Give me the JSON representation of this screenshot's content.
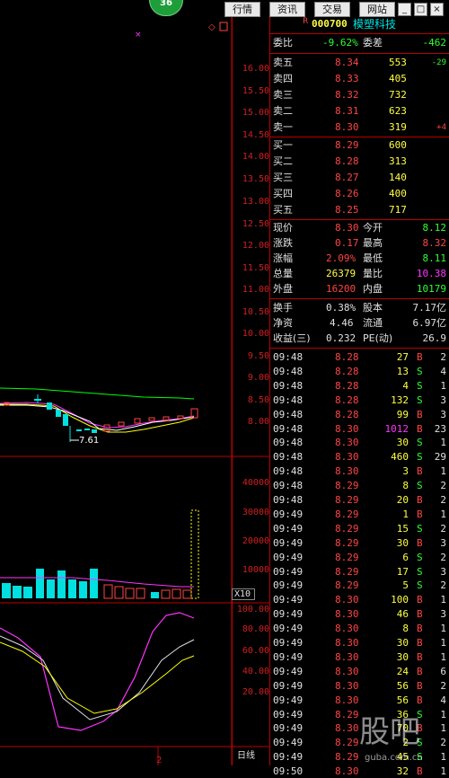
{
  "topbar": {
    "badge": "36",
    "buttons": [
      "行情",
      "资讯",
      "交易",
      "网站"
    ],
    "win_icons": [
      "minimize-icon",
      "maximize-icon",
      "close-icon"
    ]
  },
  "stock": {
    "marker": "R",
    "code": "000700",
    "name": "模塑科技"
  },
  "commission": {
    "wei_bi_label": "委比",
    "wei_bi": "-9.62%",
    "wei_cha_label": "委差",
    "wei_cha": "-462"
  },
  "sells": [
    {
      "label": "卖五",
      "price": "8.34",
      "vol": "553",
      "chg": "-29"
    },
    {
      "label": "卖四",
      "price": "8.33",
      "vol": "405",
      "chg": ""
    },
    {
      "label": "卖三",
      "price": "8.32",
      "vol": "732",
      "chg": ""
    },
    {
      "label": "卖二",
      "price": "8.31",
      "vol": "623",
      "chg": ""
    },
    {
      "label": "卖一",
      "price": "8.30",
      "vol": "319",
      "chg": "+4"
    }
  ],
  "buys": [
    {
      "label": "买一",
      "price": "8.29",
      "vol": "600"
    },
    {
      "label": "买二",
      "price": "8.28",
      "vol": "313"
    },
    {
      "label": "买三",
      "price": "8.27",
      "vol": "140"
    },
    {
      "label": "买四",
      "price": "8.26",
      "vol": "400"
    },
    {
      "label": "买五",
      "price": "8.25",
      "vol": "717"
    }
  ],
  "quote": [
    {
      "l1": "现价",
      "v1": "8.30",
      "l2": "今开",
      "v2": "8.12"
    },
    {
      "l1": "涨跌",
      "v1": "0.17",
      "l2": "最高",
      "v2": "8.32"
    },
    {
      "l1": "涨幅",
      "v1": "2.09%",
      "l2": "最低",
      "v2": "8.11"
    },
    {
      "l1": "总量",
      "v1": "26379",
      "l2": "量比",
      "v2": "10.38"
    },
    {
      "l1": "外盘",
      "v1": "16200",
      "l2": "内盘",
      "v2": "10179"
    }
  ],
  "fund": [
    {
      "l1": "换手",
      "v1": "0.38%",
      "l2": "股本",
      "v2": "7.17亿"
    },
    {
      "l1": "净资",
      "v1": "4.46",
      "l2": "流通",
      "v2": "6.97亿"
    },
    {
      "l1": "收益(三)",
      "v1": "0.232",
      "l2": "PE(动)",
      "v2": "26.9"
    }
  ],
  "ticks": [
    {
      "t": "09:48",
      "p": "8.28",
      "v": "27",
      "s": "B",
      "n": "2"
    },
    {
      "t": "09:48",
      "p": "8.28",
      "v": "13",
      "s": "S",
      "n": "4"
    },
    {
      "t": "09:48",
      "p": "8.28",
      "v": "4",
      "s": "S",
      "n": "1"
    },
    {
      "t": "09:48",
      "p": "8.28",
      "v": "132",
      "s": "S",
      "n": "3"
    },
    {
      "t": "09:48",
      "p": "8.28",
      "v": "99",
      "s": "B",
      "n": "3"
    },
    {
      "t": "09:48",
      "p": "8.30",
      "v": "1012",
      "s": "B",
      "n": "23"
    },
    {
      "t": "09:48",
      "p": "8.30",
      "v": "30",
      "s": "S",
      "n": "1"
    },
    {
      "t": "09:48",
      "p": "8.30",
      "v": "460",
      "s": "S",
      "n": "29"
    },
    {
      "t": "09:48",
      "p": "8.30",
      "v": "3",
      "s": "B",
      "n": "1"
    },
    {
      "t": "09:48",
      "p": "8.29",
      "v": "8",
      "s": "S",
      "n": "2"
    },
    {
      "t": "09:48",
      "p": "8.29",
      "v": "20",
      "s": "B",
      "n": "2"
    },
    {
      "t": "09:49",
      "p": "8.29",
      "v": "1",
      "s": "B",
      "n": "1"
    },
    {
      "t": "09:49",
      "p": "8.29",
      "v": "15",
      "s": "S",
      "n": "2"
    },
    {
      "t": "09:49",
      "p": "8.29",
      "v": "30",
      "s": "B",
      "n": "3"
    },
    {
      "t": "09:49",
      "p": "8.29",
      "v": "6",
      "s": "S",
      "n": "2"
    },
    {
      "t": "09:49",
      "p": "8.29",
      "v": "17",
      "s": "S",
      "n": "3"
    },
    {
      "t": "09:49",
      "p": "8.29",
      "v": "5",
      "s": "S",
      "n": "2"
    },
    {
      "t": "09:49",
      "p": "8.30",
      "v": "100",
      "s": "B",
      "n": "1"
    },
    {
      "t": "09:49",
      "p": "8.30",
      "v": "46",
      "s": "B",
      "n": "3"
    },
    {
      "t": "09:49",
      "p": "8.30",
      "v": "8",
      "s": "B",
      "n": "1"
    },
    {
      "t": "09:49",
      "p": "8.30",
      "v": "30",
      "s": "B",
      "n": "1"
    },
    {
      "t": "09:49",
      "p": "8.30",
      "v": "30",
      "s": "B",
      "n": "1"
    },
    {
      "t": "09:49",
      "p": "8.30",
      "v": "24",
      "s": "B",
      "n": "6"
    },
    {
      "t": "09:49",
      "p": "8.30",
      "v": "56",
      "s": "B",
      "n": "2"
    },
    {
      "t": "09:49",
      "p": "8.30",
      "v": "56",
      "s": "B",
      "n": "4"
    },
    {
      "t": "09:49",
      "p": "8.29",
      "v": "36",
      "s": "S",
      "n": "1"
    },
    {
      "t": "09:49",
      "p": "8.30",
      "v": "70",
      "s": "B",
      "n": "1"
    },
    {
      "t": "09:49",
      "p": "8.29",
      "v": "2",
      "s": "S",
      "n": "2"
    },
    {
      "t": "09:49",
      "p": "8.29",
      "v": "45",
      "s": "S",
      "n": "1"
    },
    {
      "t": "09:50",
      "p": "8.30",
      "v": "32",
      "s": "B",
      "n": "1"
    }
  ],
  "price_axis": [
    "16.00",
    "15.50",
    "15.00",
    "14.50",
    "14.00",
    "13.50",
    "13.00",
    "12.50",
    "12.00",
    "11.50",
    "11.00",
    "10.50",
    "10.00",
    "9.50",
    "9.00",
    "8.50",
    "8.00"
  ],
  "vol_axis": [
    "40000",
    "30000",
    "20000",
    "10000"
  ],
  "vol_unit": "X10",
  "ind_axis": [
    "100.00",
    "80.00",
    "60.00",
    "40.00",
    "20.00"
  ],
  "low_label": "7.61",
  "page_marker": "2",
  "period_label": "日线",
  "watermark": {
    "big": "股吧",
    "small": "guba.com.cn"
  },
  "colors": {
    "up": "#ff4444",
    "down": "#30ff30",
    "axis": "#d02020",
    "ma5": "#ffffff",
    "ma10": "#ffff00",
    "ma20": "#ff33ff",
    "ma60": "#00ff00"
  }
}
